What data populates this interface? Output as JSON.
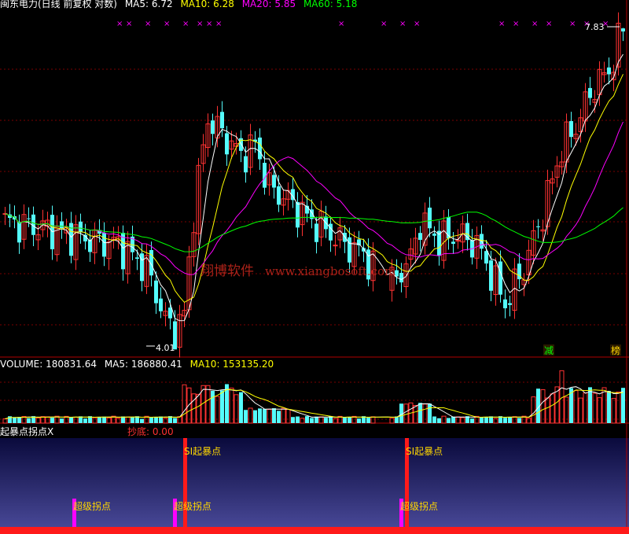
{
  "header": {
    "title": "闽东电力(日线 前复权 对数)",
    "ma5": "MA5: 6.72",
    "ma10": "MA10: 6.28",
    "ma20": "MA20: 5.85",
    "ma60": "MA60: 5.18"
  },
  "volume_header": {
    "volume": "VOLUME: 180831.64",
    "ma5": "MA5: 186880.41",
    "ma10": "MA10: 153135.20"
  },
  "indicator_header": {
    "name": "起暴点拐点X",
    "value": "抄底: 0.00"
  },
  "watermark": {
    "cn": "翔博软件",
    "url": "www.xiangbosoft.com"
  },
  "colors": {
    "up": "#ff3232",
    "down": "#54fcfc",
    "ma5": "#ffffff",
    "ma10": "#ffff00",
    "ma20": "#ff00ff",
    "ma60": "#00ff00",
    "grid": "#7a0000",
    "indicator_bg_top": "#0a0a3c",
    "indicator_bg_bottom": "#4a4a9a"
  },
  "chart_data": [
    {
      "type": "candlestick",
      "title": "闽东电力(日线 前复权 对数)",
      "scale": "log",
      "annotations": [
        {
          "text": "7.83",
          "kind": "high"
        },
        {
          "text": "4.01",
          "kind": "low"
        },
        {
          "text": "减",
          "kind": "signal"
        },
        {
          "text": "榜",
          "kind": "signal"
        }
      ],
      "marker_symbol": "×",
      "ylim": [
        3.9,
        8.1
      ]
    },
    {
      "type": "bar",
      "title": "VOLUME",
      "values_note": "daily volume, relative"
    },
    {
      "type": "signal",
      "title": "起暴点拐点X",
      "signals": [
        {
          "label": "SI起暴点",
          "kind": "big"
        },
        {
          "label": "SI起暴点",
          "kind": "big"
        },
        {
          "label": "超级拐点",
          "kind": "small"
        },
        {
          "label": "超级拐点",
          "kind": "small"
        },
        {
          "label": "超级拐点",
          "kind": "small"
        }
      ]
    }
  ]
}
